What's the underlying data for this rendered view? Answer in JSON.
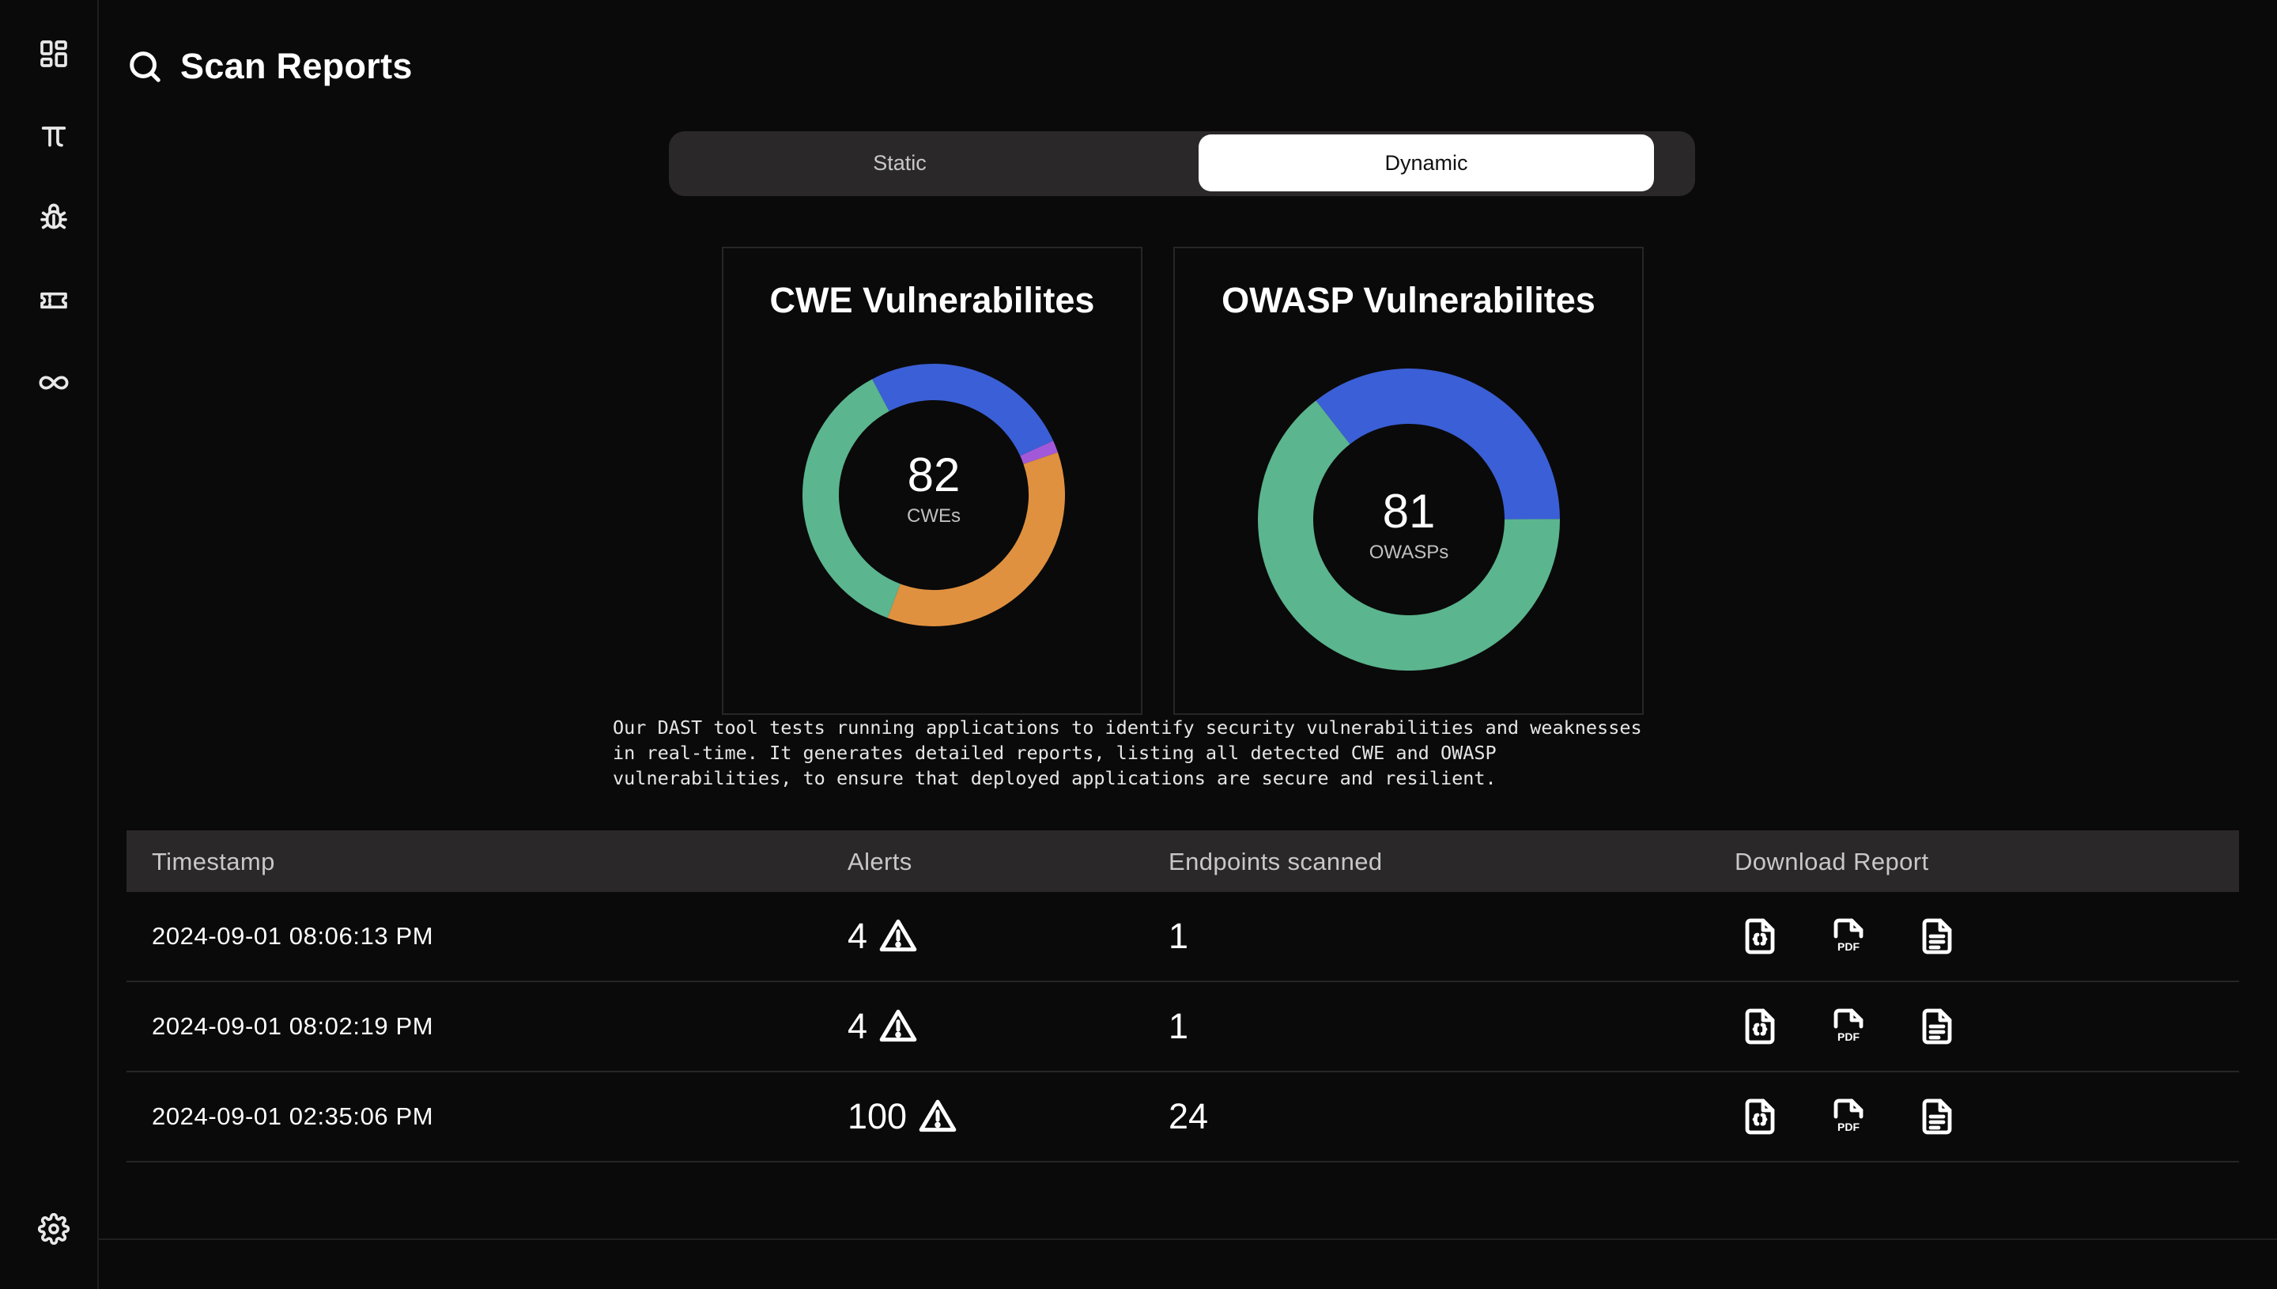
{
  "page": {
    "title": "Scan Reports",
    "title_icon": "search-icon"
  },
  "sidebar": {
    "items": [
      {
        "icon": "dashboard-icon"
      },
      {
        "icon": "pi-icon"
      },
      {
        "icon": "bug-icon"
      },
      {
        "icon": "ticket-icon"
      },
      {
        "icon": "infinity-icon"
      }
    ],
    "footer_icon": "gear-icon"
  },
  "tabs": {
    "static_label": "Static",
    "dynamic_label": "Dynamic",
    "active": "Dynamic"
  },
  "cards": {
    "cwe": {
      "title": "CWE Vulnerabilites",
      "total": "82",
      "unit": "CWEs",
      "segments": [
        {
          "fraction": 0.26,
          "color": "#3b5fd6"
        },
        {
          "fraction": 0.015,
          "color": "#a259d9"
        },
        {
          "fraction": 0.36,
          "color": "#e0913f"
        },
        {
          "fraction": 0.365,
          "color": "#5bb58f"
        }
      ]
    },
    "owasp": {
      "title": "OWASP Vulnerabilites",
      "total": "81",
      "unit": "OWASPs",
      "segments": [
        {
          "fraction": 0.355,
          "color": "#3b5fd6"
        },
        {
          "fraction": 0.645,
          "color": "#5bb58f"
        }
      ]
    }
  },
  "description": "Our DAST tool tests running applications to identify security vulnerabilities and weaknesses in real-time. It generates detailed reports, listing all detected CWE and OWASP vulnerabilities, to ensure that deployed applications are secure and resilient.",
  "table": {
    "headers": {
      "timestamp": "Timestamp",
      "alerts": "Alerts",
      "endpoints": "Endpoints scanned",
      "download": "Download Report"
    },
    "rows": [
      {
        "timestamp": "2024-09-01 08:06:13 PM",
        "alerts": "4",
        "endpoints": "1"
      },
      {
        "timestamp": "2024-09-01 08:02:19 PM",
        "alerts": "4",
        "endpoints": "1"
      },
      {
        "timestamp": "2024-09-01 02:35:06 PM",
        "alerts": "100",
        "endpoints": "24"
      }
    ],
    "download_icons": [
      "json-file-icon",
      "pdf-file-icon",
      "text-file-icon"
    ]
  }
}
